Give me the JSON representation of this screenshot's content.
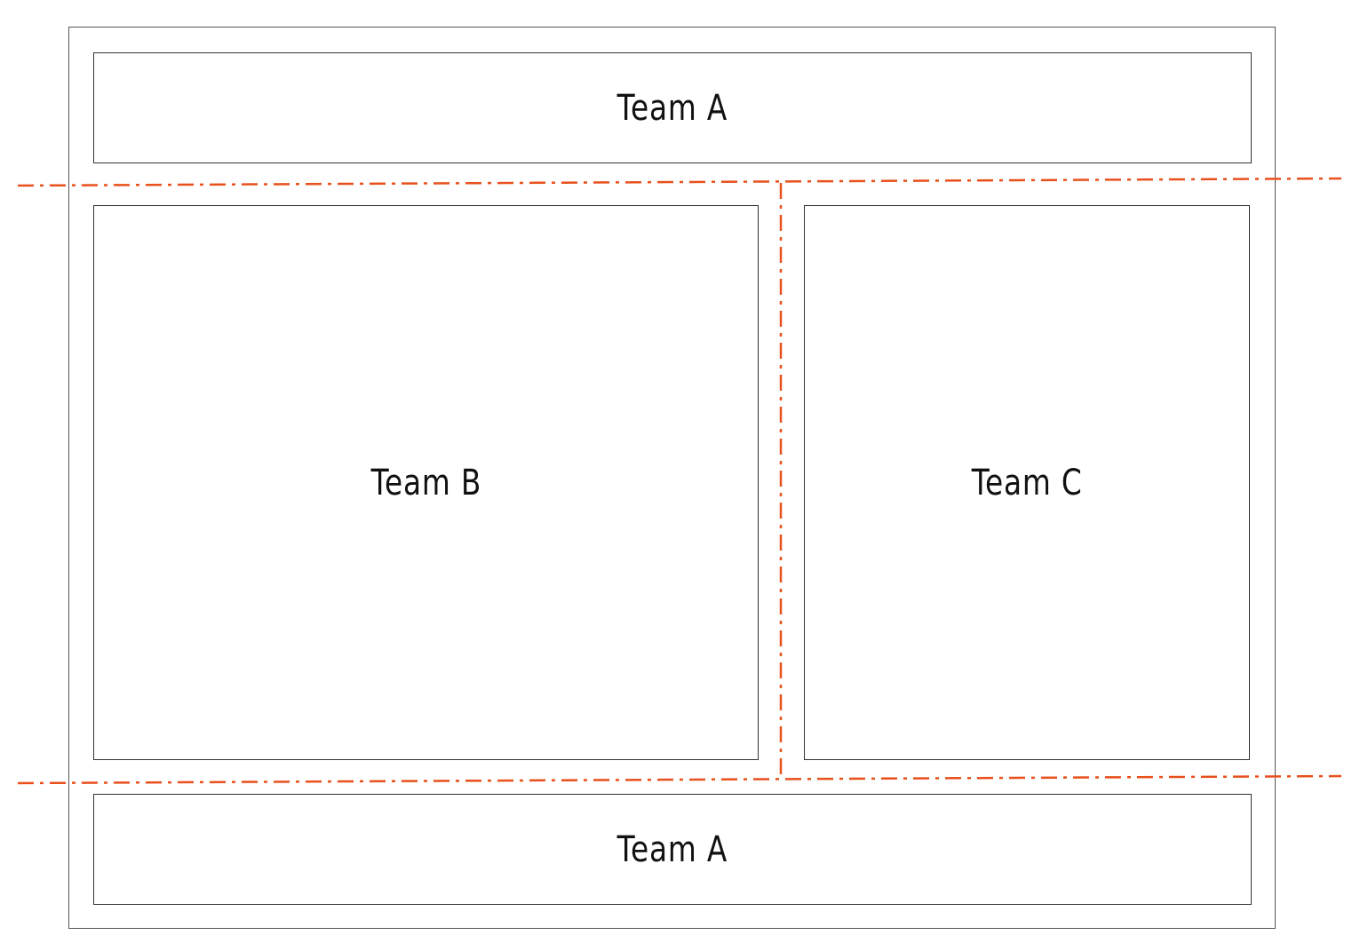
{
  "diagram": {
    "regions": {
      "top": {
        "label": "Team A"
      },
      "left": {
        "label": "Team B"
      },
      "right": {
        "label": "Team C"
      },
      "bottom": {
        "label": "Team A"
      }
    },
    "boundary_style": "dash-dot",
    "boundary_color": "#e8501c",
    "frame_color": "#555555",
    "box_border_color": "#333333"
  }
}
